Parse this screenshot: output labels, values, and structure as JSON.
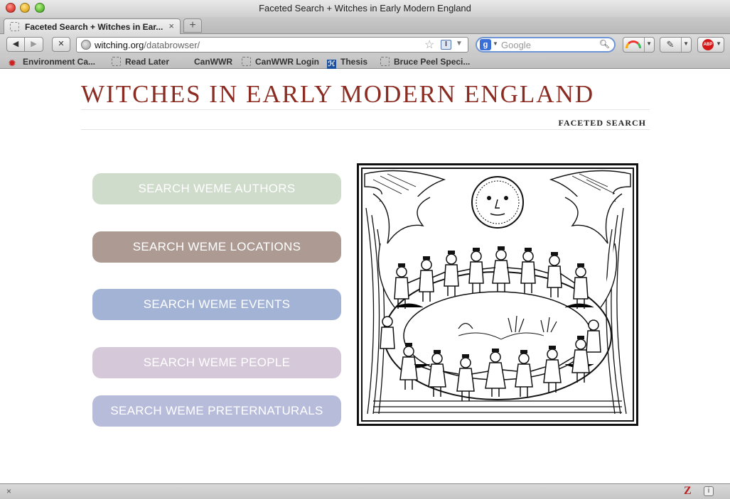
{
  "window": {
    "title": "Faceted Search + Witches in Early Modern England"
  },
  "tabs": [
    {
      "label": "Faceted Search + Witches in Ear..."
    }
  ],
  "toolbar": {
    "back_glyph": "◀",
    "forward_glyph": "▶",
    "stop_glyph": "✕",
    "url_host": "witching.org",
    "url_path": "/databrowser/",
    "search_placeholder": "Google",
    "search_value": "",
    "search_engine_glyph": "g",
    "addons": [
      "rainbow-icon",
      "wrench-icon",
      "adblock-icon"
    ],
    "abp_label": "ABP"
  },
  "bookmarks": [
    {
      "label": "Environment Ca...",
      "icon": "maple-leaf-icon"
    },
    {
      "label": "Read Later",
      "icon": "page-icon"
    },
    {
      "label": "CanWWR",
      "icon": "none"
    },
    {
      "label": "CanWWR Login",
      "icon": "page-icon"
    },
    {
      "label": "Thesis",
      "icon": "zotero-icon"
    },
    {
      "label": "Bruce Peel Speci...",
      "icon": "page-icon"
    }
  ],
  "page": {
    "site_title": "WITCHES IN EARLY MODERN ENGLAND",
    "subtitle": "FACETED SEARCH",
    "buttons": [
      {
        "label": "SEARCH WEME AUTHORS",
        "color": "#cfdbcb"
      },
      {
        "label": "SEARCH WEME LOCATIONS",
        "color": "#ad9a93"
      },
      {
        "label": "SEARCH WEME EVENTS",
        "color": "#a3b3d6"
      },
      {
        "label": "SEARCH WEME PEOPLE",
        "color": "#d5c8d9"
      },
      {
        "label": "SEARCH WEME PRETERNATURALS",
        "color": "#b8bcdb"
      }
    ],
    "title_color": "#8a2c22"
  },
  "statusbar": {
    "close_glyph": "×",
    "zotero_glyph": "Z",
    "info_glyph": "i"
  }
}
